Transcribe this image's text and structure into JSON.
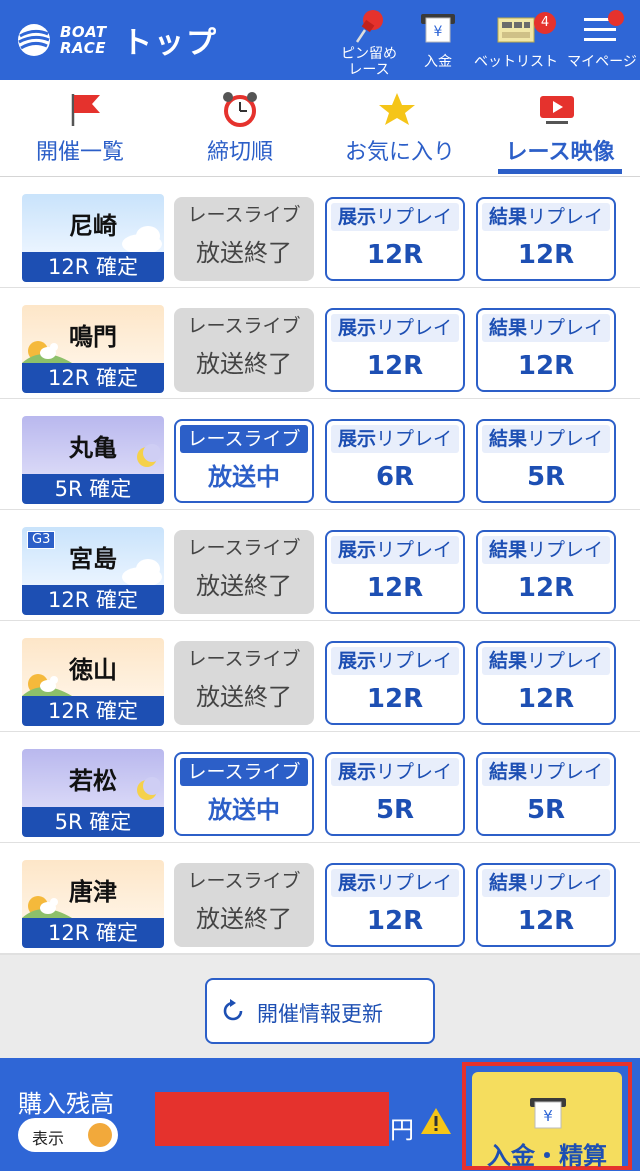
{
  "header": {
    "logo_line1": "BOAT",
    "logo_line2": "RACE",
    "title": "トップ",
    "pin_label_1": "ピン留め",
    "pin_label_2": "レース",
    "deposit_label": "入金",
    "betlist_label": "ベットリスト",
    "betlist_count": "4",
    "mypage_label": "マイページ"
  },
  "tabs": [
    {
      "label": "開催一覧",
      "icon": "flag-icon"
    },
    {
      "label": "締切順",
      "icon": "alarm-clock-icon"
    },
    {
      "label": "お気に入り",
      "icon": "star-icon"
    },
    {
      "label": "レース映像",
      "icon": "video-icon",
      "active": true
    }
  ],
  "live_header": "レースライブ",
  "tenji_header_bold": "展示",
  "tenji_header_rest": "リプレイ",
  "kekka_header_bold": "結果",
  "kekka_header_rest": "リプレイ",
  "rows": [
    {
      "venue": "尼崎",
      "status": "12R 確定",
      "theme": "day",
      "live": "放送終了",
      "live_on": false,
      "tenji": "12R",
      "kekka": "12R"
    },
    {
      "venue": "鳴門",
      "status": "12R 確定",
      "theme": "dawn",
      "live": "放送終了",
      "live_on": false,
      "tenji": "12R",
      "kekka": "12R"
    },
    {
      "venue": "丸亀",
      "status": "5R 確定",
      "theme": "night",
      "live": "放送中",
      "live_on": true,
      "tenji": "6R",
      "kekka": "5R"
    },
    {
      "venue": "宮島",
      "status": "12R 確定",
      "theme": "day",
      "grade": "G3",
      "live": "放送終了",
      "live_on": false,
      "tenji": "12R",
      "kekka": "12R"
    },
    {
      "venue": "徳山",
      "status": "12R 確定",
      "theme": "dawn",
      "live": "放送終了",
      "live_on": false,
      "tenji": "12R",
      "kekka": "12R"
    },
    {
      "venue": "若松",
      "status": "5R 確定",
      "theme": "night",
      "live": "放送中",
      "live_on": true,
      "tenji": "5R",
      "kekka": "5R"
    },
    {
      "venue": "唐津",
      "status": "12R 確定",
      "theme": "dawn",
      "live": "放送終了",
      "live_on": false,
      "tenji": "12R",
      "kekka": "12R"
    }
  ],
  "refresh_label": "開催情報更新",
  "footer": {
    "balance_label": "購入残高",
    "toggle_label": "表示",
    "yen": "円",
    "deposit_settle": "入金・精算"
  },
  "colors": {
    "brand_blue": "#2f66d6",
    "accent_red": "#e5322d",
    "deposit_yellow": "#f5dd5e"
  }
}
